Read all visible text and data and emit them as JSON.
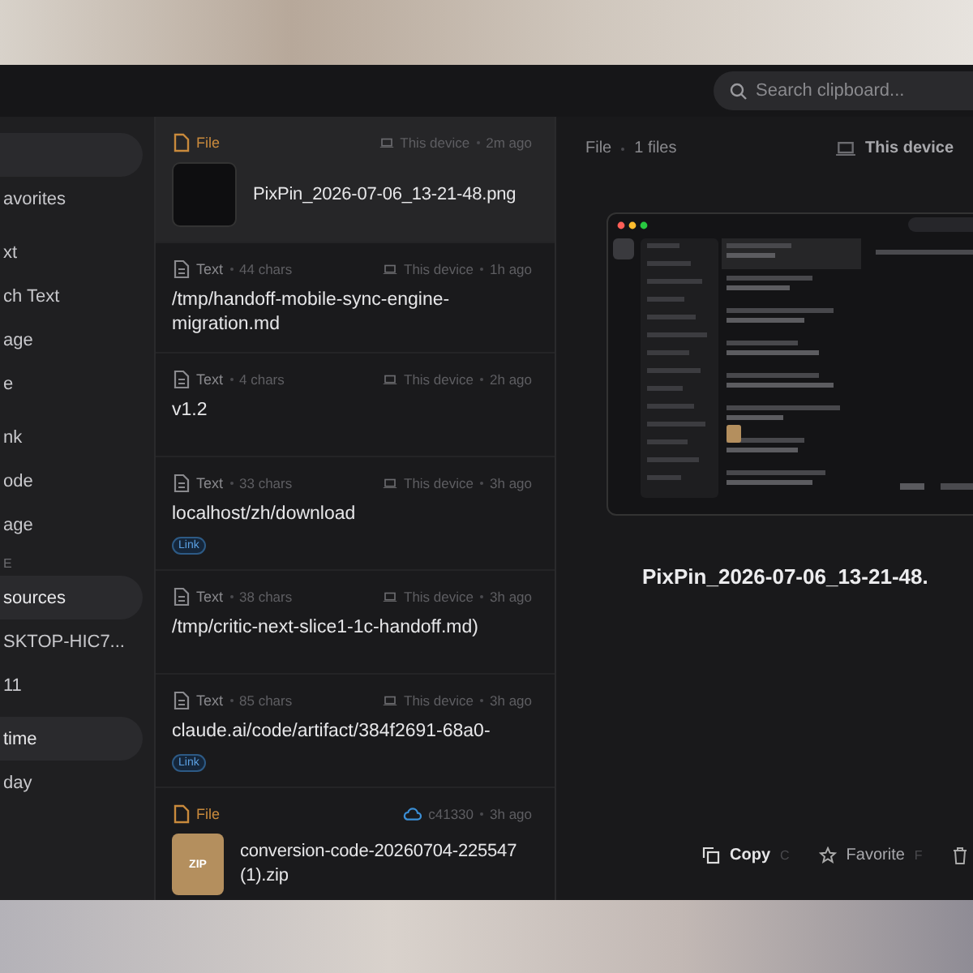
{
  "toolbar": {
    "search": {
      "placeholder": "Search clipboard..."
    }
  },
  "sidebar": {
    "groups": [
      {
        "items": [
          {
            "selected": true
          },
          {
            "label": "avorites",
            "selected": false
          }
        ]
      },
      {
        "items": [
          {
            "label": "xt",
            "selected": false
          },
          {
            "label": "ch Text",
            "selected": false
          },
          {
            "label": "age",
            "selected": false
          },
          {
            "label": "e",
            "selected": false
          }
        ]
      },
      {
        "items": [
          {
            "label": "nk",
            "selected": false
          },
          {
            "label": "ode",
            "selected": false
          },
          {
            "label": "age",
            "selected": false
          }
        ]
      },
      {
        "header": "E",
        "items": [
          {
            "label": "sources",
            "selected": true
          },
          {
            "label": "SKTOP-HIC7...",
            "selected": false
          },
          {
            "label": "11",
            "selected": false
          }
        ]
      },
      {
        "items": [
          {
            "label": "time",
            "selected": true
          },
          {
            "label": "day",
            "selected": false
          }
        ]
      }
    ]
  },
  "list": {
    "items": [
      {
        "kind": "file",
        "type": "File",
        "source": {
          "kind": "device",
          "label": "This device"
        },
        "time": "2m ago",
        "content": "PixPin_2026-07-06_13-21-48.png",
        "thumbnail": {
          "kind": "screenshot"
        },
        "selected": true
      },
      {
        "kind": "text",
        "type": "Text",
        "chars": "44 chars",
        "source": {
          "kind": "device",
          "label": "This device"
        },
        "time": "1h ago",
        "content": "/tmp/handoff-mobile-sync-engine-migration.md",
        "selected": false
      },
      {
        "kind": "text",
        "type": "Text",
        "chars": "4 chars",
        "source": {
          "kind": "device",
          "label": "This device"
        },
        "time": "2h ago",
        "content": "v1.2",
        "selected": false
      },
      {
        "kind": "text",
        "type": "Text",
        "chars": "33 chars",
        "source": {
          "kind": "device",
          "label": "This device"
        },
        "time": "3h ago",
        "content": "localhost/zh/download",
        "tag": "Link",
        "selected": false
      },
      {
        "kind": "text",
        "type": "Text",
        "chars": "38 chars",
        "source": {
          "kind": "device",
          "label": "This device"
        },
        "time": "3h ago",
        "content": "/tmp/critic-next-slice1-1c-handoff.md)",
        "selected": false
      },
      {
        "kind": "text",
        "type": "Text",
        "chars": "85 chars",
        "source": {
          "kind": "device",
          "label": "This device"
        },
        "time": "3h ago",
        "content": "claude.ai/code/artifact/384f2691-68a0-",
        "tag": "Link",
        "selected": false
      },
      {
        "kind": "file",
        "type": "File",
        "source": {
          "kind": "cloud",
          "label": "c41330"
        },
        "time": "3h ago",
        "content": "conversion-code-20260704-225547 (1).zip",
        "thumbnail": {
          "kind": "zip",
          "label": "ZIP"
        },
        "selected": false
      }
    ]
  },
  "detail": {
    "type": "File",
    "count": "1 files",
    "source": "This device",
    "filename": "PixPin_2026-07-06_13-21-48.",
    "actions": [
      {
        "kind": "copy",
        "label": "Copy",
        "shortcut": "C"
      },
      {
        "kind": "favorite",
        "label": "Favorite",
        "shortcut": "F"
      },
      {
        "kind": "delete"
      }
    ]
  }
}
